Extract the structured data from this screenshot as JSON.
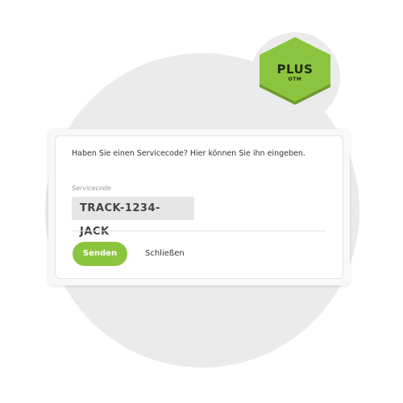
{
  "badge": {
    "title": "PLUS",
    "subtitle": "OTM",
    "color": "#8bc53f"
  },
  "form": {
    "prompt": "Haben Sie einen Servicecode? Hier können Sie ihn eingeben.",
    "field_label": "Servicecode",
    "field_value": "TRACK-1234-JACK",
    "submit_label": "Senden",
    "close_label": "Schließen"
  },
  "colors": {
    "accent": "#8bc53f",
    "background_circle": "#ebebeb"
  }
}
